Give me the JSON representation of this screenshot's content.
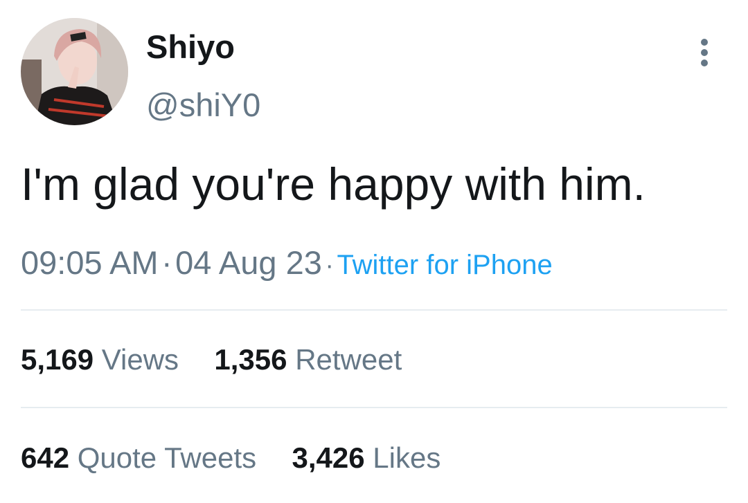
{
  "user": {
    "display_name": "Shiyo",
    "handle": "@shiY0"
  },
  "tweet": {
    "text": "I'm glad you're happy with him.",
    "time": "09:05 AM",
    "separator": "·",
    "date": "04 Aug 23",
    "source": "Twitter for iPhone"
  },
  "stats": {
    "views_count": "5,169",
    "views_label": "Views",
    "retweets_count": "1,356",
    "retweets_label": "Retweet",
    "quotes_count": "642",
    "quotes_label": "Quote Tweets",
    "likes_count": "3,426",
    "likes_label": "Likes"
  },
  "icons": {
    "more": "more-vertical-icon"
  },
  "colors": {
    "text": "#14171a",
    "secondary": "#657786",
    "link": "#1da1f2",
    "divider": "#e6ecf0"
  }
}
